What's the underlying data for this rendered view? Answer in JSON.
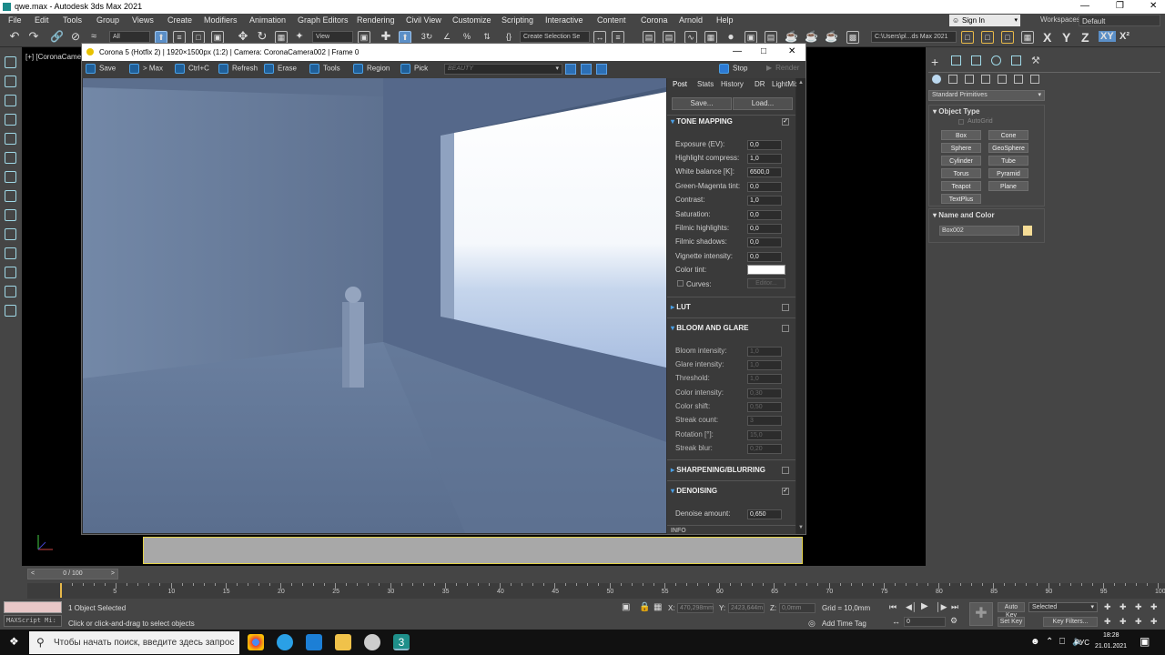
{
  "window": {
    "title": "qwe.max - Autodesk 3ds Max 2021"
  },
  "menu": [
    "File",
    "Edit",
    "Tools",
    "Group",
    "Views",
    "Create",
    "Modifiers",
    "Animation",
    "Graph Editors",
    "Rendering",
    "Civil View",
    "Customize",
    "Scripting",
    "Interactive",
    "Content",
    "Corona",
    "Arnold",
    "Help"
  ],
  "account": {
    "signin": "Sign In",
    "workspaces_label": "Workspaces:",
    "workspace": "Default"
  },
  "toolbar": {
    "selection_filter": "All",
    "ref_coord": "View",
    "create_selection_set": "Create Selection Se",
    "project_path": "C:\\Users\\pl...ds Max 2021",
    "axes": [
      "X",
      "Y",
      "Z",
      "XY"
    ],
    "axis_extra": "X²"
  },
  "viewport": {
    "label": "[+] [CoronaCamera"
  },
  "corona": {
    "title": "Corona 5 (Hotfix 2) | 1920×1500px (1:2) | Camera: CoronaCamera002 | Frame 0",
    "toolbar": {
      "save": "Save",
      "to_max": "> Max",
      "ctrlc": "Ctrl+C",
      "refresh": "Refresh",
      "erase": "Erase",
      "tools": "Tools",
      "region": "Region",
      "pick": "Pick",
      "beauty": "BEAUTY",
      "stop": "Stop",
      "render": "Render"
    },
    "tabs": [
      "Post",
      "Stats",
      "History",
      "DR",
      "LightMix"
    ],
    "save_btn": "Save...",
    "load_btn": "Load...",
    "tone_mapping": {
      "title": "TONE MAPPING",
      "rows": [
        {
          "label": "Exposure (EV):",
          "value": "0,0"
        },
        {
          "label": "Highlight compress:",
          "value": "1,0"
        },
        {
          "label": "White balance [K]:",
          "value": "6500,0"
        },
        {
          "label": "Green-Magenta tint:",
          "value": "0,0"
        },
        {
          "label": "Contrast:",
          "value": "1,0"
        },
        {
          "label": "Saturation:",
          "value": "0,0"
        },
        {
          "label": "Filmic highlights:",
          "value": "0,0"
        },
        {
          "label": "Filmic shadows:",
          "value": "0,0"
        },
        {
          "label": "Vignette intensity:",
          "value": "0,0"
        }
      ],
      "color_tint": "Color tint:",
      "curves": "Curves:",
      "editor": "Editor..."
    },
    "lut": "LUT",
    "bloom": {
      "title": "BLOOM AND GLARE",
      "rows": [
        {
          "label": "Bloom intensity:",
          "value": "1,0"
        },
        {
          "label": "Glare intensity:",
          "value": "1,0"
        },
        {
          "label": "Threshold:",
          "value": "1,0"
        },
        {
          "label": "Color intensity:",
          "value": "0,30"
        },
        {
          "label": "Color shift:",
          "value": "0,50"
        },
        {
          "label": "Streak count:",
          "value": "3"
        },
        {
          "label": "Rotation [°]:",
          "value": "15,0"
        },
        {
          "label": "Streak blur:",
          "value": "0,20"
        }
      ]
    },
    "sharpening": "SHARPENING/BLURRING",
    "denoising": {
      "title": "DENOISING",
      "label": "Denoise amount:",
      "value": "0,650"
    },
    "info": "INFO"
  },
  "command_panel": {
    "category": "Standard Primitives",
    "object_type": "Object Type",
    "autogrid": "AutoGrid",
    "buttons": [
      "Box",
      "Cone",
      "Sphere",
      "GeoSphere",
      "Cylinder",
      "Tube",
      "Torus",
      "Pyramid",
      "Teapot",
      "Plane",
      "TextPlus"
    ],
    "name_and_color": "Name and Color",
    "object_name": "Box002",
    "object_color": "#f5dc96"
  },
  "timeline": {
    "frame": "0 / 100",
    "ticks": [
      "5",
      "10",
      "15",
      "20",
      "25",
      "30",
      "35",
      "40",
      "45",
      "50",
      "55",
      "60",
      "65",
      "70",
      "75",
      "80",
      "85",
      "90",
      "95",
      "100"
    ]
  },
  "status": {
    "maxscript": "MAXScript Mi:",
    "selected": "1 Object Selected",
    "prompt": "Click or click-and-drag to select objects",
    "x_label": "X:",
    "x_value": "470,298mm",
    "y_label": "Y:",
    "y_value": "2423,644m",
    "z_label": "Z:",
    "z_value": "0,0mm",
    "grid": "Grid = 10,0mm",
    "add_time_tag": "Add Time Tag",
    "auto_key": "Auto Key",
    "set_key": "Set Key",
    "key_mode": "Selected",
    "key_filters": "Key Filters...",
    "current_frame": "0"
  },
  "taskbar": {
    "search": "Чтобы начать поиск, введите здесь запрос",
    "lang": "РУС",
    "time": "18:28",
    "date": "21.01.2021"
  }
}
